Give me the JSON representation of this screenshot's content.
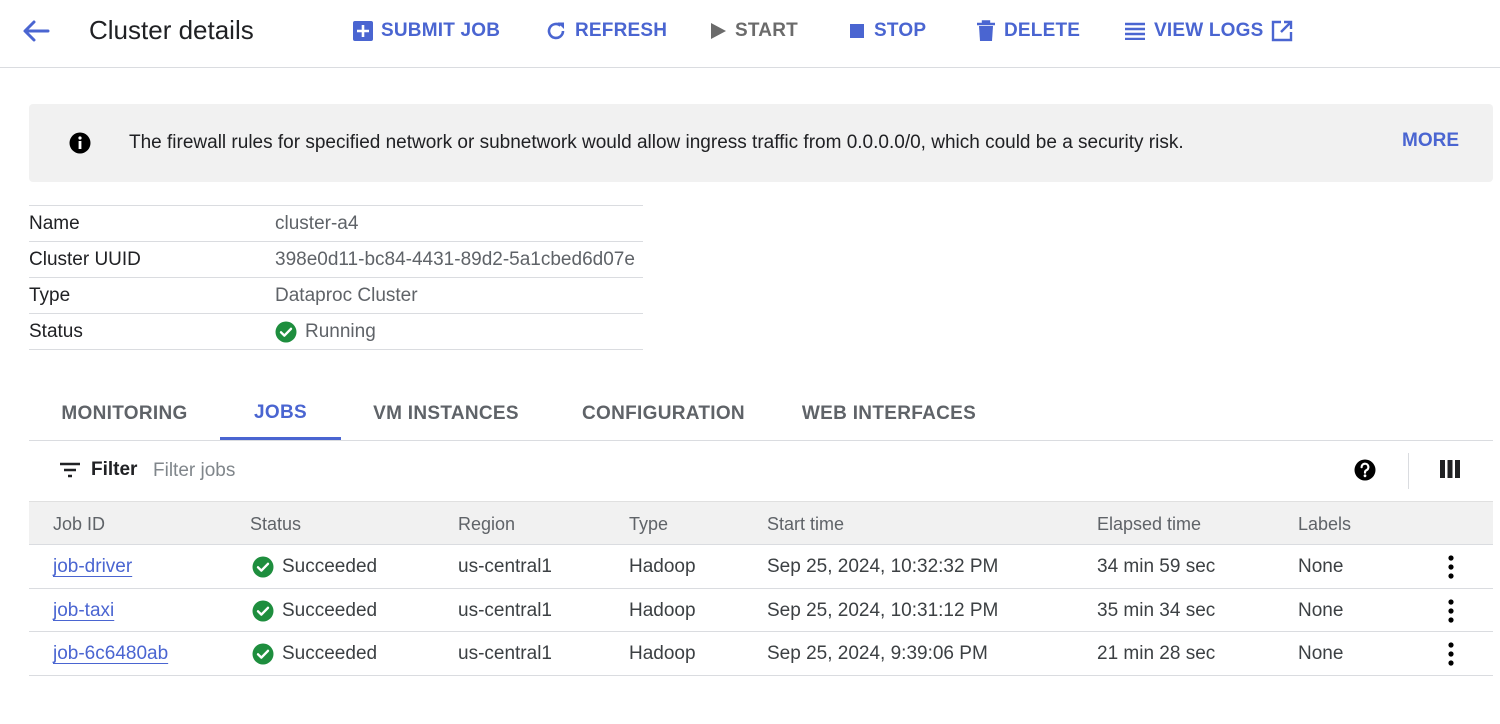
{
  "header": {
    "title": "Cluster details",
    "actions": {
      "submit_job": "SUBMIT JOB",
      "refresh": "REFRESH",
      "start": "START",
      "stop": "STOP",
      "delete": "DELETE",
      "view_logs": "VIEW LOGS"
    }
  },
  "banner": {
    "icon": "info-icon",
    "text": "The firewall rules for specified network or subnetwork would allow ingress traffic from 0.0.0.0/0, which could be a security risk.",
    "more_label": "MORE"
  },
  "details": {
    "rows": [
      {
        "label": "Name",
        "value": "cluster-a4"
      },
      {
        "label": "Cluster UUID",
        "value": "398e0d11-bc84-4431-89d2-5a1cbed6d07e"
      },
      {
        "label": "Type",
        "value": "Dataproc Cluster"
      },
      {
        "label": "Status",
        "value": "Running",
        "icon": "check-circle-icon"
      }
    ]
  },
  "tabs": [
    {
      "label": "MONITORING",
      "active": false
    },
    {
      "label": "JOBS",
      "active": true
    },
    {
      "label": "VM INSTANCES",
      "active": false
    },
    {
      "label": "CONFIGURATION",
      "active": false
    },
    {
      "label": "WEB INTERFACES",
      "active": false
    }
  ],
  "filter": {
    "label": "Filter",
    "placeholder": "Filter jobs"
  },
  "jobs_table": {
    "columns": [
      "Job ID",
      "Status",
      "Region",
      "Type",
      "Start time",
      "Elapsed time",
      "Labels"
    ],
    "rows": [
      {
        "job_id": "job-driver",
        "status": "Succeeded",
        "region": "us-central1",
        "type": "Hadoop",
        "start_time": "Sep 25, 2024, 10:32:32 PM",
        "elapsed": "34 min 59 sec",
        "labels": "None"
      },
      {
        "job_id": "job-taxi",
        "status": "Succeeded",
        "region": "us-central1",
        "type": "Hadoop",
        "start_time": "Sep 25, 2024, 10:31:12 PM",
        "elapsed": "35 min 34 sec",
        "labels": "None"
      },
      {
        "job_id": "job-6c6480ab",
        "status": "Succeeded",
        "region": "us-central1",
        "type": "Hadoop",
        "start_time": "Sep 25, 2024, 9:39:06 PM",
        "elapsed": "21 min 28 sec",
        "labels": "None"
      }
    ]
  },
  "colors": {
    "accent": "#4a65d1",
    "success": "#1e8e3e",
    "banner_bg": "#f1f1f1"
  }
}
